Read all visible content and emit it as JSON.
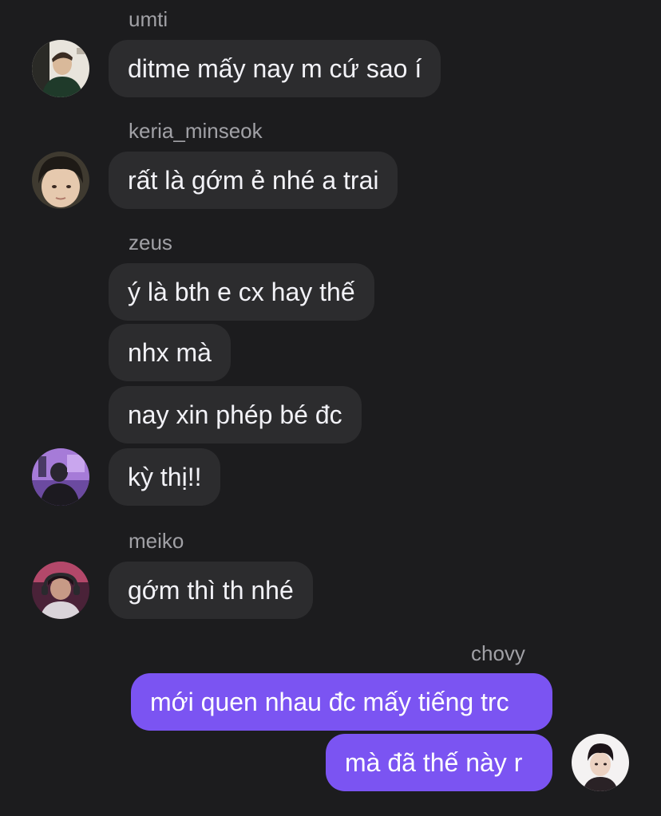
{
  "thread": {
    "groups": [
      {
        "sender": "umti",
        "avatar_icon": "user-avatar-umti",
        "messages": [
          "ditme mấy nay m cứ sao í"
        ]
      },
      {
        "sender": "keria_minseok",
        "avatar_icon": "user-avatar-keria-minseok",
        "messages": [
          "rất là gớm ẻ nhé a trai"
        ]
      },
      {
        "sender": "zeus",
        "avatar_icon": "user-avatar-zeus",
        "messages": [
          "ý là bth e cx hay thế",
          "nhx mà",
          "nay xin phép bé đc",
          "kỳ thị!!"
        ]
      },
      {
        "sender": "meiko",
        "avatar_icon": "user-avatar-meiko",
        "messages": [
          "gớm thì th nhé"
        ]
      },
      {
        "sender": "chovy",
        "avatar_icon": "user-avatar-chovy",
        "messages": [
          "mới quen nhau đc mấy tiếng trc",
          "mà đã thế này r"
        ]
      }
    ]
  },
  "colors": {
    "background": "#1c1c1e",
    "incoming_bubble": "#2c2c2e",
    "outgoing_bubble": "#7b54f2",
    "sender_name": "#a1a1a6",
    "message_text": "#f2f2f7"
  }
}
